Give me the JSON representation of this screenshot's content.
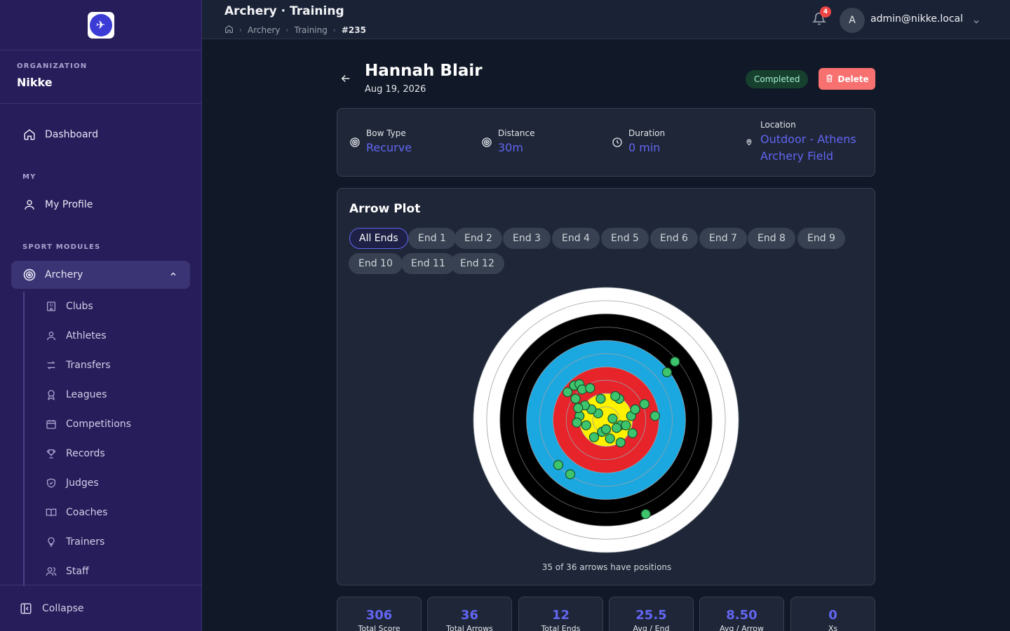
{
  "sidebar": {
    "org_label": "ORGANIZATION",
    "org_name": "Nikke",
    "dashboard": "Dashboard",
    "my_label": "MY",
    "my_profile": "My Profile",
    "modules_label": "SPORT MODULES",
    "archery": "Archery",
    "sub_items": [
      "Clubs",
      "Athletes",
      "Transfers",
      "Leagues",
      "Competitions",
      "Records",
      "Judges",
      "Coaches",
      "Trainers",
      "Staff"
    ],
    "collapse": "Collapse"
  },
  "topbar": {
    "title": "Archery · Training",
    "breadcrumb": [
      "Archery",
      "Training",
      "#235"
    ],
    "notification_count": "4",
    "avatar_initial": "A",
    "user_email": "admin@nikke.local"
  },
  "session": {
    "athlete": "Hannah Blair",
    "date": "Aug 19, 2026",
    "status": "Completed",
    "delete_label": "Delete"
  },
  "info": {
    "bow_type_label": "Bow Type",
    "bow_type": "Recurve",
    "distance_label": "Distance",
    "distance": "30m",
    "duration_label": "Duration",
    "duration": "0 min",
    "location_label": "Location",
    "location_line1": "Outdoor - Athens",
    "location_line2": "Archery Field"
  },
  "plot": {
    "title": "Arrow Plot",
    "filters": [
      "All Ends",
      "End 1",
      "End 2",
      "End 3",
      "End 4",
      "End 5",
      "End 6",
      "End 7",
      "End 8",
      "End 9",
      "End 10",
      "End 11",
      "End 12"
    ],
    "selected_filter": "All Ends",
    "note": "35 of 36 arrows have positions",
    "ring_colors": [
      "#ffffff",
      "#ffffff",
      "#000000",
      "#000000",
      "#1ba8e0",
      "#1ba8e0",
      "#e8242b",
      "#e8242b",
      "#fff200",
      "#fff200"
    ],
    "arrow_color": "#3ec46d",
    "arrows": [
      [
        -0.03,
        0.09
      ],
      [
        -0.29,
        -0.21
      ],
      [
        -0.24,
        -0.26
      ],
      [
        -0.2,
        -0.27
      ],
      [
        -0.18,
        -0.23
      ],
      [
        -0.12,
        -0.24
      ],
      [
        -0.23,
        -0.16
      ],
      [
        -0.04,
        -0.16
      ],
      [
        0.1,
        -0.16
      ],
      [
        -0.06,
        -0.05
      ],
      [
        -0.11,
        -0.08
      ],
      [
        0.19,
        -0.03
      ],
      [
        0.29,
        -0.12
      ],
      [
        0.22,
        -0.08
      ],
      [
        0.52,
        -0.44
      ],
      [
        0.46,
        -0.36
      ],
      [
        0.07,
        -0.18
      ],
      [
        0.2,
        0.1
      ],
      [
        0.11,
        0.04
      ],
      [
        0.05,
        -0.01
      ],
      [
        0.08,
        0.06
      ],
      [
        0.15,
        0.04
      ],
      [
        0.11,
        0.17
      ],
      [
        0.03,
        0.14
      ],
      [
        0.0,
        0.07
      ],
      [
        -0.15,
        0.04
      ],
      [
        -0.2,
        -0.03
      ],
      [
        -0.16,
        -0.11
      ],
      [
        -0.09,
        0.13
      ],
      [
        -0.36,
        0.34
      ],
      [
        -0.27,
        0.41
      ],
      [
        -0.21,
        -0.09
      ],
      [
        0.37,
        -0.03
      ],
      [
        -0.22,
        0.02
      ],
      [
        0.3,
        0.71
      ]
    ]
  },
  "stats": [
    {
      "value": "306",
      "label": "Total Score"
    },
    {
      "value": "36",
      "label": "Total Arrows"
    },
    {
      "value": "12",
      "label": "Total Ends"
    },
    {
      "value": "25.5",
      "label": "Avg / End"
    },
    {
      "value": "8.50",
      "label": "Avg / Arrow"
    },
    {
      "value": "0",
      "label": "Xs"
    }
  ]
}
